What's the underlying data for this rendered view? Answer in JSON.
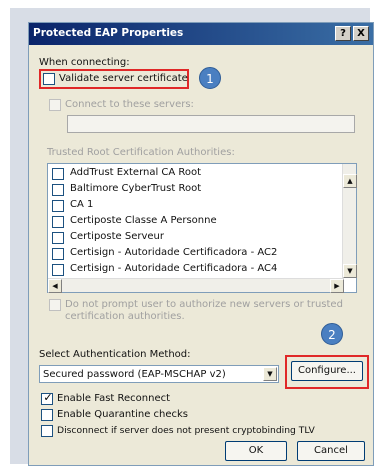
{
  "dialog": {
    "title": "Protected EAP Properties",
    "help_button": "?",
    "close_button": "X"
  },
  "when_connecting": "When connecting:",
  "validate_server_certificate": {
    "label": "Validate server certificate",
    "checked": false
  },
  "connect_to_servers": {
    "label": "Connect to these servers:",
    "value": ""
  },
  "trusted_root_heading": "Trusted Root Certification Authorities:",
  "trusted_roots": [
    "AddTrust External CA Root",
    "Baltimore CyberTrust Root",
    "CA 1",
    "Certiposte Classe A Personne",
    "Certiposte Serveur",
    "Certisign - Autoridade Certificadora - AC2",
    "Certisign - Autoridade Certificadora - AC4"
  ],
  "do_not_prompt": {
    "line1": "Do not prompt user to authorize new servers or trusted",
    "line2": "certification authorities."
  },
  "select_auth_method": "Select Authentication Method:",
  "auth_method_value": "Secured password (EAP-MSCHAP v2)",
  "configure_button": "Configure...",
  "enable_fast_reconnect": {
    "label": "Enable Fast Reconnect",
    "checked": true
  },
  "enable_quarantine": {
    "label": "Enable Quarantine checks",
    "checked": false
  },
  "disconnect_cryptobinding": {
    "label": "Disconnect if server does not present cryptobinding TLV",
    "checked": false
  },
  "ok_button": "OK",
  "cancel_button": "Cancel",
  "callouts": [
    "1",
    "2"
  ],
  "colors": {
    "callout_blue": "#4a7fc1",
    "highlight_red": "#e02828",
    "titlebar_blue": "#0a246a"
  }
}
